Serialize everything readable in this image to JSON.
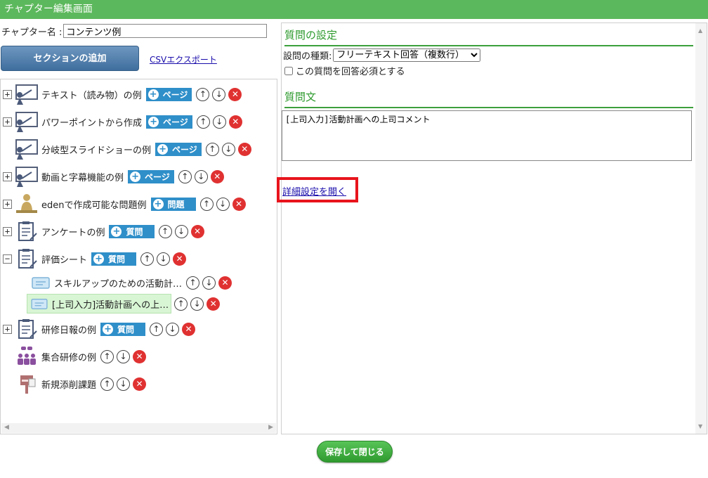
{
  "window": {
    "title": "チャプター編集画面"
  },
  "chapter": {
    "name_label": "チャプター名 :",
    "name_value": "コンテンツ例"
  },
  "toolbar": {
    "add_section": "セクションの追加",
    "csv_export": "CSVエクスポート"
  },
  "tree": {
    "items": [
      {
        "label": "テキスト（読み物）の例",
        "tag": "ページ",
        "expander": "+",
        "icon": "presentation-icon"
      },
      {
        "label": "パワーポイントから作成",
        "tag": "ページ",
        "expander": "+",
        "icon": "presentation-icon"
      },
      {
        "label": "分岐型スライドショーの例",
        "tag": "ページ",
        "expander": "",
        "icon": "presentation-icon"
      },
      {
        "label": "動画と字幕機能の例",
        "tag": "ページ",
        "expander": "+",
        "icon": "presentation-icon"
      },
      {
        "label": "edenで作成可能な問題例",
        "tag": "問題",
        "expander": "+",
        "icon": "writing-person-icon"
      },
      {
        "label": "アンケートの例",
        "tag": "質問",
        "expander": "+",
        "icon": "clipboard-icon"
      },
      {
        "label": "評価シート",
        "tag": "質問",
        "expander": "−",
        "icon": "clipboard-icon"
      },
      {
        "label": "スキルアップのための活動計…",
        "icon": "card-icon"
      },
      {
        "label": "[上司入力]活動計画への上…",
        "icon": "card-icon",
        "selected": true
      },
      {
        "label": "研修日報の例",
        "tag": "質問",
        "expander": "+",
        "icon": "clipboard-icon"
      },
      {
        "label": "集合研修の例",
        "icon": "group-meeting-icon"
      },
      {
        "label": "新規添削課題",
        "icon": "post-box-icon"
      }
    ]
  },
  "question_settings": {
    "heading": "質問の設定",
    "type_label": "設問の種類:",
    "type_selected": "フリーテキスト回答（複数行）",
    "required_label": "この質問を回答必須とする",
    "required_checked": false
  },
  "question_text": {
    "heading": "質問文",
    "value": "[上司入力]活動計画への上司コメント"
  },
  "detail_link": "詳細設定を開く",
  "footer": {
    "save_close": "保存して閉じる"
  },
  "colors": {
    "title_bar": "#5cb85c",
    "accent_green": "#3ca03c",
    "tag_blue": "#2f8fc9",
    "delete_red": "#e03131",
    "highlight_red": "#e8141c"
  }
}
